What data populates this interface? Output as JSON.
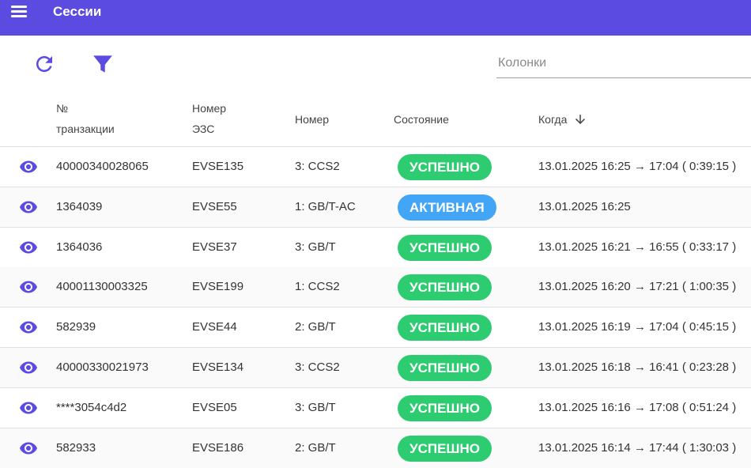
{
  "appbar": {
    "title": "Сессии"
  },
  "toolbar": {
    "columns_placeholder": "Колонки"
  },
  "colors": {
    "appbar": "#5b4be0",
    "accent": "#5b4be0",
    "success": "#2ecc71",
    "active": "#42a5f5"
  },
  "table": {
    "headers": {
      "transaction_line1": "№",
      "transaction_line2": "транзакции",
      "evse_line1": "Номер",
      "evse_line2": "ЭЗС",
      "connector": "Номер",
      "state": "Состояние",
      "when": "Когда"
    },
    "rows": [
      {
        "transaction": "40000340028065",
        "evse": "EVSE135",
        "connector": "3: CCS2",
        "state": "УСПЕШНО",
        "when": "13.01.2025 16:25 → 17:04 ( 0:39:15 )"
      },
      {
        "transaction": "1364039",
        "evse": "EVSE55",
        "connector": "1: GB/T-AC",
        "state": "АКТИВНАЯ",
        "when": "13.01.2025 16:25"
      },
      {
        "transaction": "1364036",
        "evse": "EVSE37",
        "connector": "3: GB/T",
        "state": "УСПЕШНО",
        "when": "13.01.2025 16:21 → 16:55 ( 0:33:17 )"
      },
      {
        "transaction": "40001130003325",
        "evse": "EVSE199",
        "connector": "1: CCS2",
        "state": "УСПЕШНО",
        "when": "13.01.2025 16:20 → 17:21 ( 1:00:35 )"
      },
      {
        "transaction": "582939",
        "evse": "EVSE44",
        "connector": "2: GB/T",
        "state": "УСПЕШНО",
        "when": "13.01.2025 16:19 → 17:04 ( 0:45:15 )"
      },
      {
        "transaction": "40000330021973",
        "evse": "EVSE134",
        "connector": "3: CCS2",
        "state": "УСПЕШНО",
        "when": "13.01.2025 16:18 → 16:41 ( 0:23:28 )"
      },
      {
        "transaction": "****3054c4d2",
        "evse": "EVSE05",
        "connector": "3: GB/T",
        "state": "УСПЕШНО",
        "when": "13.01.2025 16:16 → 17:08 ( 0:51:24 )"
      },
      {
        "transaction": "582933",
        "evse": "EVSE186",
        "connector": "2: GB/T",
        "state": "УСПЕШНО",
        "when": "13.01.2025 16:14 → 17:44 ( 1:30:03 )"
      }
    ]
  }
}
